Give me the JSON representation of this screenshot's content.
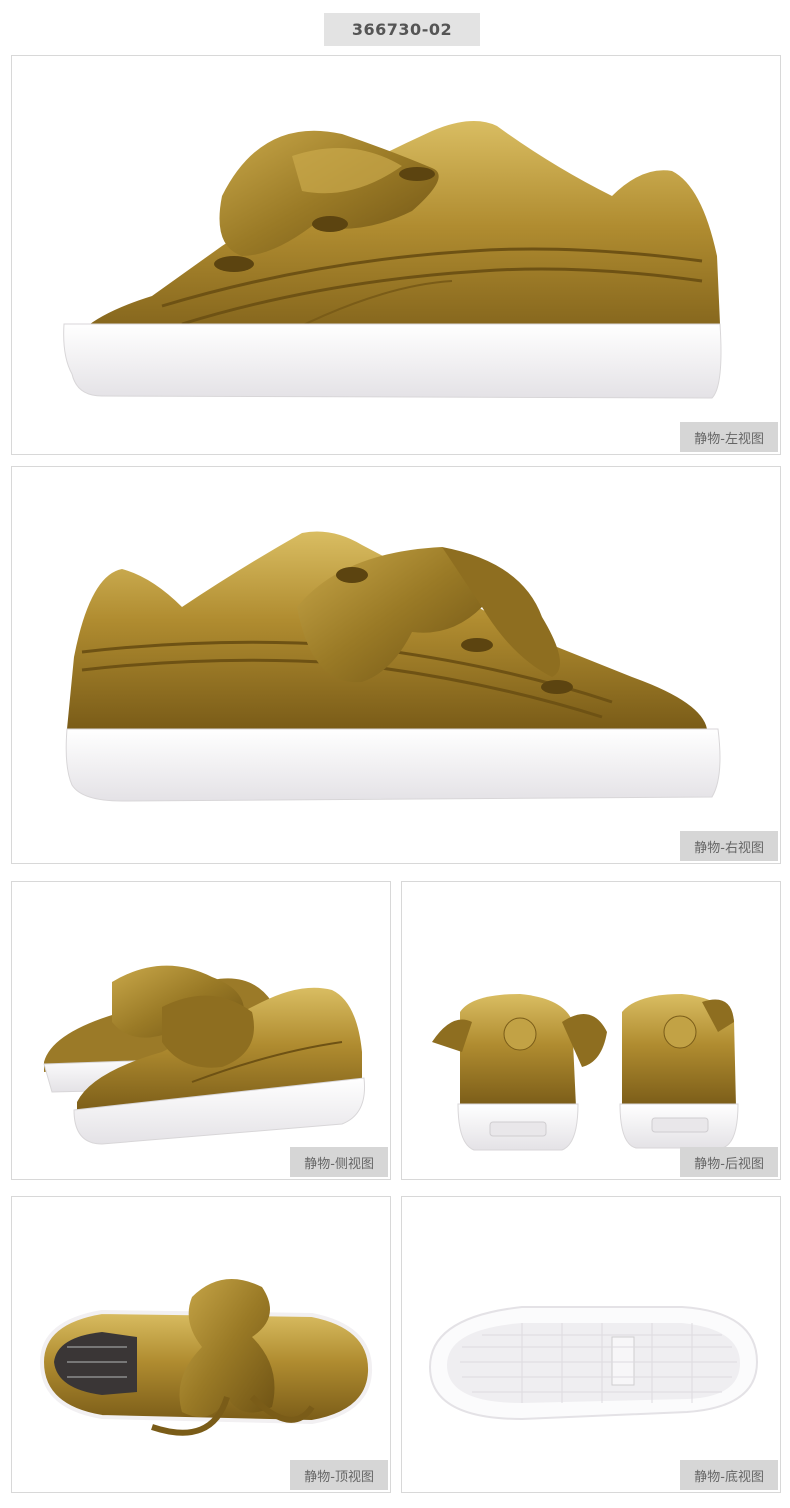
{
  "sku": "366730-02",
  "views": [
    {
      "label": "静物-左视图",
      "icon": "sneaker-left-view-image"
    },
    {
      "label": "静物-右视图",
      "icon": "sneaker-right-view-image"
    },
    {
      "label": "静物-侧视图",
      "icon": "sneaker-pair-side-view-image"
    },
    {
      "label": "静物-后视图",
      "icon": "sneaker-pair-back-view-image"
    },
    {
      "label": "静物-顶视图",
      "icon": "sneaker-top-view-image"
    },
    {
      "label": "静物-底视图",
      "icon": "sneaker-bottom-view-image"
    }
  ],
  "colors": {
    "gold": "#a8842c",
    "gold_light": "#d4b45a",
    "gold_dark": "#6e5214",
    "sole": "#f4f2f0",
    "tag_bg": "#d6d6d6"
  }
}
